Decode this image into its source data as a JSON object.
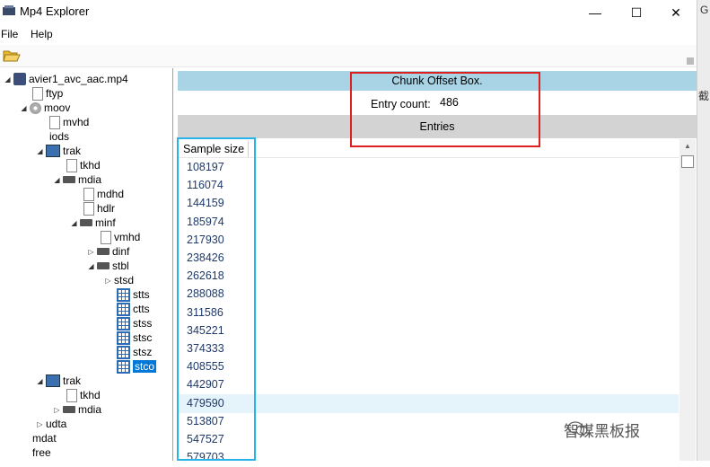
{
  "window": {
    "title": "Mp4 Explorer",
    "minimize_glyph": "—",
    "maximize_glyph": "☐",
    "close_glyph": "✕"
  },
  "menu": {
    "file": "File",
    "help": "Help"
  },
  "tree": {
    "root": "avier1_avc_aac.mp4",
    "ftyp": "ftyp",
    "moov": "moov",
    "mvhd": "mvhd",
    "iods": "iods",
    "trak1": "trak",
    "tkhd1": "tkhd",
    "mdia1": "mdia",
    "mdhd": "mdhd",
    "hdlr": "hdlr",
    "minf": "minf",
    "vmhd": "vmhd",
    "dinf": "dinf",
    "stbl": "stbl",
    "stsd": "stsd",
    "stts": "stts",
    "ctts": "ctts",
    "stss": "stss",
    "stsc": "stsc",
    "stsz": "stsz",
    "stco": "stco",
    "trak2": "trak",
    "tkhd2": "tkhd",
    "mdia2": "mdia",
    "udta": "udta",
    "mdat": "mdat",
    "free": "free"
  },
  "box": {
    "title": "Chunk Offset Box.",
    "entry_count_label": "Entry count:",
    "entry_count_value": "486",
    "entries_header": "Entries"
  },
  "table": {
    "column": "Sample size",
    "rows": [
      "108197",
      "116074",
      "144159",
      "185974",
      "217930",
      "238426",
      "262618",
      "288088",
      "311586",
      "345221",
      "374333",
      "408555",
      "442907",
      "479590",
      "513807",
      "547527",
      "579703"
    ]
  },
  "side_strip": {
    "top_char": "G",
    "mid_char": "截"
  },
  "watermark": "智媒黑板报",
  "colors": {
    "header_blue": "#a8d4e6",
    "red_annotation": "#e02020",
    "blue_annotation": "#29b3e8",
    "selection": "#0078d7"
  }
}
